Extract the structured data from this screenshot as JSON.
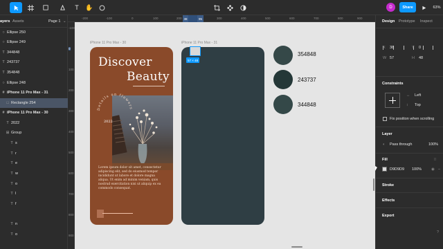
{
  "left_panel": {
    "tabs": {
      "layers": "ayers",
      "assets": "Assets",
      "page": "Page 1"
    },
    "layers": [
      {
        "icon": "○",
        "label": "Ellipse 250"
      },
      {
        "icon": "○",
        "label": "Ellipse 249"
      },
      {
        "icon": "T",
        "label": "344848"
      },
      {
        "icon": "T",
        "label": "243737"
      },
      {
        "icon": "T",
        "label": "354848"
      },
      {
        "icon": "○",
        "label": "Ellipse 248"
      },
      {
        "icon": "#",
        "label": "iPhone 11 Pro Max - 31"
      },
      {
        "icon": "□",
        "label": "Rectangle 254"
      },
      {
        "icon": "#",
        "label": "iPhone 11 Pro Max - 30"
      },
      {
        "icon": "T",
        "label": "2022"
      },
      {
        "icon": "⊞",
        "label": "Group"
      },
      {
        "icon": "T",
        "label": "s"
      },
      {
        "icon": "T",
        "label": "r"
      },
      {
        "icon": "T",
        "label": "e"
      },
      {
        "icon": "T",
        "label": "w"
      },
      {
        "icon": "T",
        "label": "o"
      },
      {
        "icon": "T",
        "label": "l"
      },
      {
        "icon": "T",
        "label": "f"
      },
      {
        "icon": "T",
        "label": "n"
      },
      {
        "icon": "T",
        "label": "o"
      }
    ]
  },
  "toolbar": {
    "avatar": "D",
    "share": "Share",
    "zoom": "63%"
  },
  "ruler_top": {
    "ticks": [
      "-200",
      "-100",
      "0",
      "100",
      "200",
      "300",
      "400",
      "500",
      "600",
      "700",
      "800",
      "900",
      "1000"
    ],
    "hl_start": "38",
    "hl_end": "95"
  },
  "ruler_left": {
    "ticks": [
      "-100",
      "0",
      "100",
      "200",
      "300",
      "400",
      "500",
      "600",
      "700",
      "800",
      "900"
    ]
  },
  "canvas": {
    "frame1_label": "iPhone 11 Pro Max - 30",
    "frame2_label": "iPhone 11 Pro Max - 31",
    "title_line1": "Discover",
    "title_line2": "Beauty",
    "circular_text": "Details on flowers",
    "year": "2022",
    "lorem": "Lorem ipsum dolor sit amet, consectetur adipiscing elit, sed do eiusmod tempor incididunt ut labore et dolore magna aliqua. Ut enim ad minim veniam, quis nostrud exercitation nisi ut aliquip ex ea commodo consequat.",
    "selection_size": "57 × 48",
    "swatches": [
      {
        "label": "354848",
        "color": "#354848"
      },
      {
        "label": "243737",
        "color": "#243737"
      },
      {
        "label": "344848",
        "color": "#344848"
      }
    ]
  },
  "right_panel": {
    "tabs": [
      "Design",
      "Prototype",
      "Inspect"
    ],
    "x_label": "X",
    "x_value": "38",
    "y_label": "Y",
    "y_value": "0",
    "w_label": "W",
    "w_value": "57",
    "h_label": "H",
    "h_value": "48",
    "constraints_title": "Constraints",
    "constraint_h": "Left",
    "constraint_v": "Top",
    "fix_position": "Fix position when scrolling",
    "layer_title": "Layer",
    "blend_mode": "Pass through",
    "layer_opacity": "100%",
    "fill_title": "Fill",
    "fill_hex": "D9D9D9",
    "fill_opacity": "100%",
    "stroke_title": "Stroke",
    "effects_title": "Effects",
    "export_title": "Export"
  },
  "colors": {
    "accent": "#0d99ff",
    "phone1": "#8a4a2a",
    "phone2": "#2f3e44",
    "avatar": "#c52bcd"
  }
}
